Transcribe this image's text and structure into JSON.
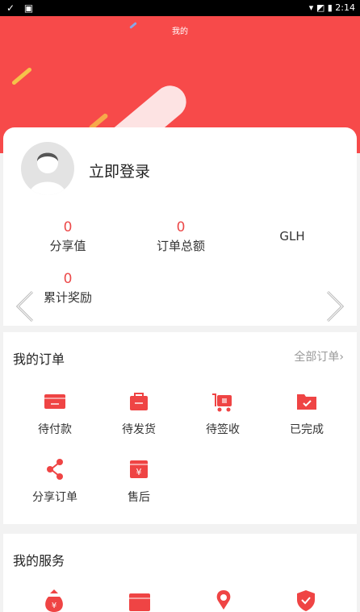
{
  "status": {
    "left_icons": "✓ ▣",
    "time": "2:14"
  },
  "header": {
    "title": "我的"
  },
  "profile": {
    "login_label": "立即登录"
  },
  "stats": [
    {
      "value": "0",
      "label": "分享值"
    },
    {
      "value": "0",
      "label": "订单总额"
    },
    {
      "value": "",
      "label": "GLH"
    },
    {
      "value": "0",
      "label": "累计奖励"
    }
  ],
  "orders": {
    "title": "我的订单",
    "all_label": "全部订单›",
    "items": [
      {
        "label": "待付款",
        "icon": "wallet-icon"
      },
      {
        "label": "待发货",
        "icon": "bag-icon"
      },
      {
        "label": "待签收",
        "icon": "cart-icon"
      },
      {
        "label": "已完成",
        "icon": "folder-check-icon"
      },
      {
        "label": "分享订单",
        "icon": "share-icon"
      },
      {
        "label": "售后",
        "icon": "yuan-box-icon"
      }
    ]
  },
  "services": {
    "title": "我的服务"
  },
  "colors": {
    "accent": "#f74a4a",
    "accent_text": "#ec4a4a"
  }
}
